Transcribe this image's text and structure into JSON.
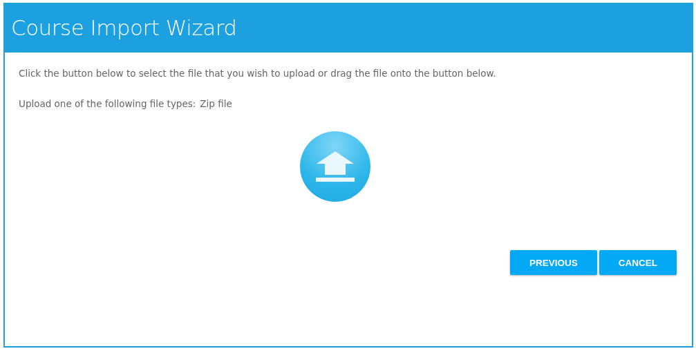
{
  "window": {
    "title": "Course Import Wizard"
  },
  "instructions": "Click the button below to select the file that you wish to upload or drag the file onto the button below.",
  "file_types": {
    "label": "Upload one of the following file types:",
    "value": "Zip file"
  },
  "buttons": [
    {
      "label": "PREVIOUS"
    },
    {
      "label": "CANCEL"
    }
  ]
}
